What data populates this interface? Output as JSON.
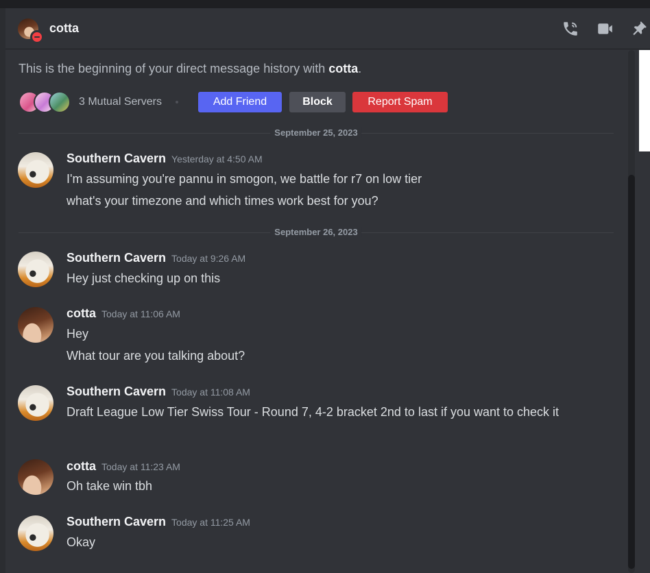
{
  "header": {
    "name": "cotta",
    "icons": [
      "phone-call-icon",
      "video-camera-icon",
      "pin-icon"
    ]
  },
  "intro": {
    "prefix": "This is the beginning of your direct message history with ",
    "name": "cotta",
    "suffix": "."
  },
  "mutual": {
    "label": "3 Mutual Servers",
    "add_friend": "Add Friend",
    "block": "Block",
    "report_spam": "Report Spam"
  },
  "dividers": [
    "September 25, 2023",
    "September 26, 2023"
  ],
  "groups": [
    {
      "author": "Southern Cavern",
      "timestamp": "Yesterday at 4:50 AM",
      "lines": [
        "I'm assuming you're pannu in smogon, we battle for r7 on low tier",
        "what's your timezone and which times work best for you?"
      ]
    },
    {
      "author": "Southern Cavern",
      "timestamp": "Today at 9:26 AM",
      "lines": [
        "Hey just checking up on this"
      ]
    },
    {
      "author": "cotta",
      "timestamp": "Today at 11:06 AM",
      "lines": [
        "Hey",
        "What tour are you talking about?"
      ]
    },
    {
      "author": "Southern Cavern",
      "timestamp": "Today at 11:08 AM",
      "lines": [
        "Draft League Low Tier Swiss Tour - Round 7, 4-2 bracket 2nd to last if you want to check it"
      ]
    },
    {
      "author": "cotta",
      "timestamp": "Today at 11:23 AM",
      "lines": [
        "Oh take win tbh"
      ]
    },
    {
      "author": "Southern Cavern",
      "timestamp": "Today at 11:25 AM",
      "lines": [
        "Okay"
      ]
    }
  ],
  "colors": {
    "background": "#313338",
    "blurple": "#5865f2",
    "danger": "#da373c",
    "secondary": "#4e5058",
    "dnd_status": "#f23f43"
  }
}
